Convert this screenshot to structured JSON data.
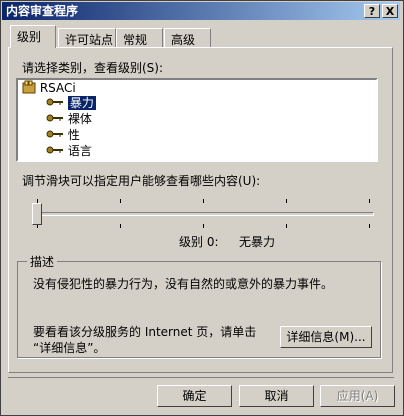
{
  "window": {
    "title": "内容审查程序",
    "help_button": "?",
    "close_button": "X"
  },
  "tabs": [
    {
      "label": "级别"
    },
    {
      "label": "许可站点"
    },
    {
      "label": "常规"
    },
    {
      "label": "高级"
    }
  ],
  "category": {
    "label": "请选择类别，查看级别(S):",
    "root": "RSACi",
    "items": [
      {
        "label": "暴力",
        "selected": true
      },
      {
        "label": "裸体"
      },
      {
        "label": "性"
      },
      {
        "label": "语言"
      }
    ]
  },
  "slider": {
    "label": "调节滑块可以指定用户能够查看哪些内容(U):",
    "level": 0,
    "level_text": "级别 0:",
    "level_desc": "无暴力"
  },
  "description": {
    "title": "描述",
    "text": "没有侵犯性的暴力行为，没有自然的或意外的暴力事件。",
    "more_line1": "要看看该分级服务的 Internet 页，请单击",
    "more_line2": "“详细信息”。",
    "details_button": "详细信息(M)..."
  },
  "buttons": {
    "ok": "确定",
    "cancel": "取消",
    "apply": "应用(A)"
  }
}
